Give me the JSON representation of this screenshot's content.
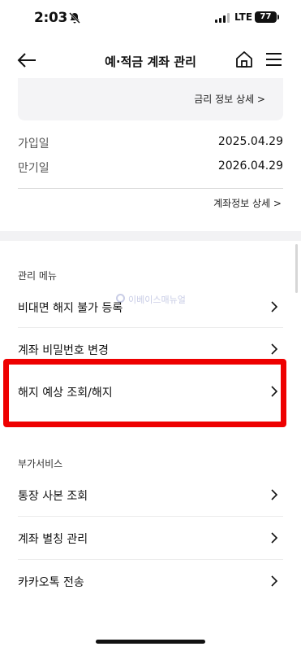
{
  "status": {
    "time": "2:03",
    "network": "LTE",
    "battery": "77"
  },
  "header": {
    "title": "예·적금 계좌 관리"
  },
  "rate_box": {
    "link": "금리 정보 상세 >"
  },
  "dates": [
    {
      "label": "가입일",
      "value": "2025.04.29"
    },
    {
      "label": "만기일",
      "value": "2026.04.29"
    }
  ],
  "account_link": "계좌정보 상세 >",
  "watermark": "이베이스매뉴얼",
  "manage_menu": {
    "title": "관리 메뉴",
    "items": [
      {
        "label": "비대면 해지 불가 등록"
      },
      {
        "label": "계좌 비밀번호 변경"
      },
      {
        "label": "해지 예상 조회/해지"
      }
    ]
  },
  "extra_services": {
    "title": "부가서비스",
    "items": [
      {
        "label": "통장 사본 조회"
      },
      {
        "label": "계좌 별칭 관리"
      },
      {
        "label": "카카오톡 전송"
      }
    ]
  },
  "colors": {
    "highlight": "#ee0000",
    "panel": "#f4f4f6"
  }
}
